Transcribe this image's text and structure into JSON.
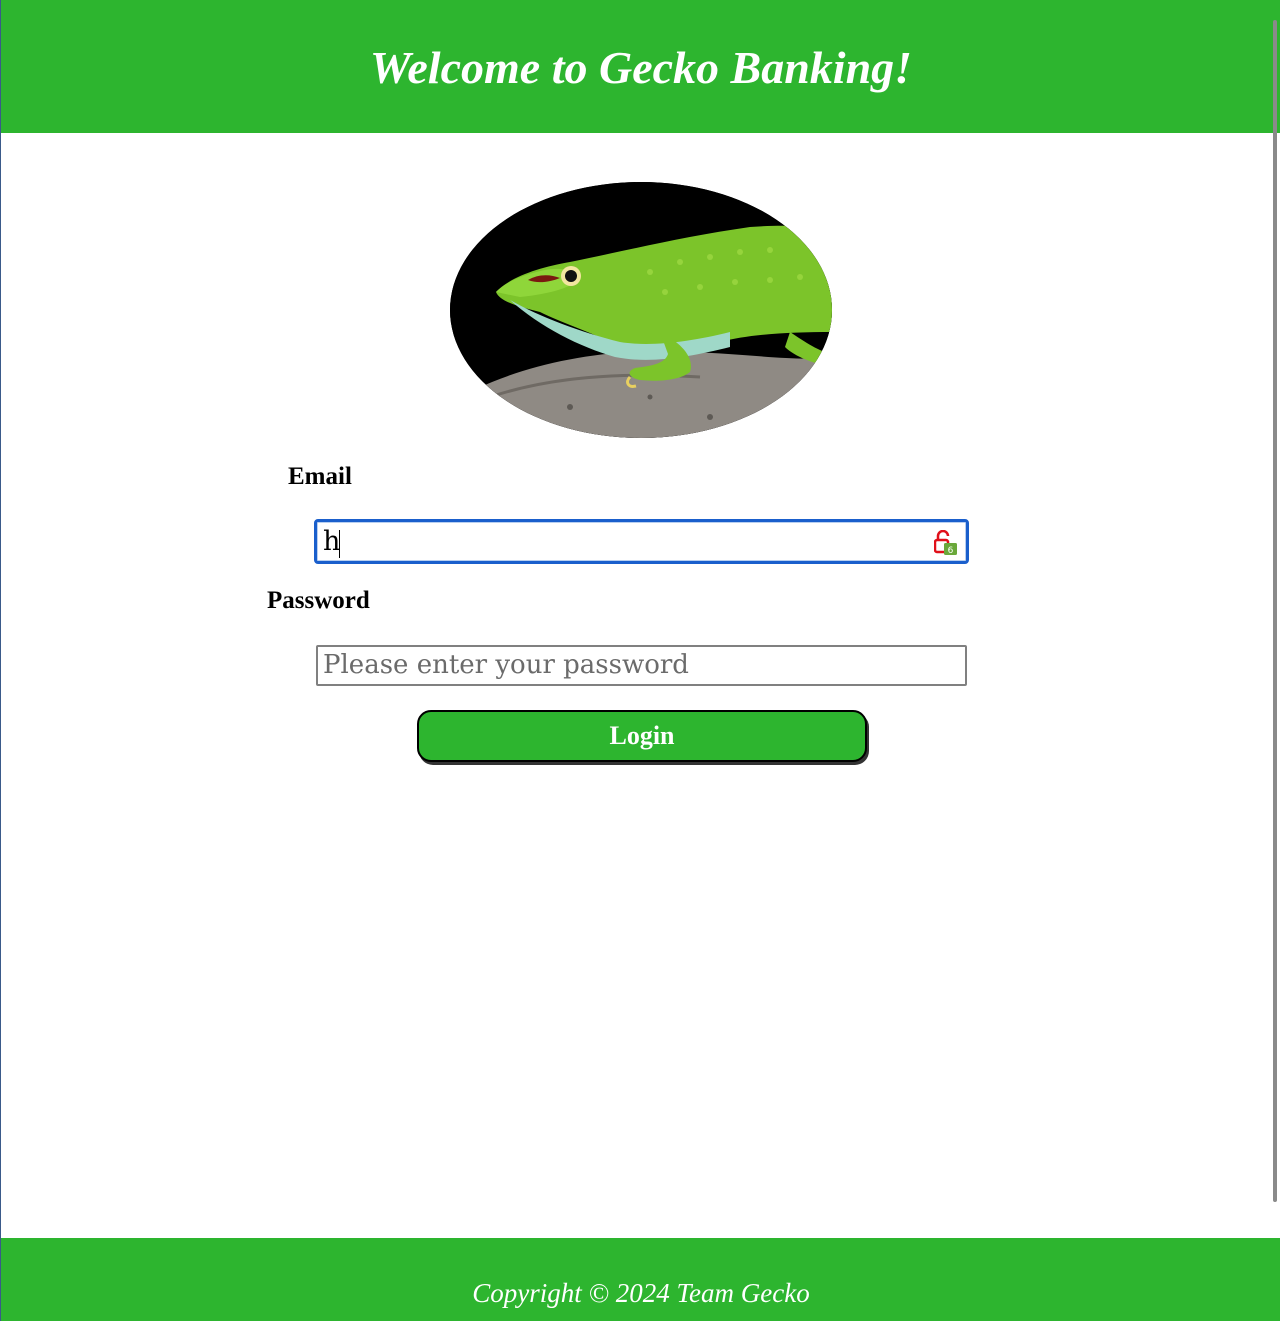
{
  "header": {
    "title": "Welcome to Gecko Banking!"
  },
  "logo": {
    "description": "green gecko on a rock",
    "icon": "gecko-logo-image"
  },
  "form": {
    "email_label": "Email",
    "email_value": "h",
    "password_label": "Password",
    "password_placeholder": "Please enter your password",
    "login_label": "Login"
  },
  "footer": {
    "copyright": "Copyright © 2024 Team Gecko"
  },
  "colors": {
    "brand_green": "#2db52f",
    "focus_blue": "#1a5fcc"
  }
}
